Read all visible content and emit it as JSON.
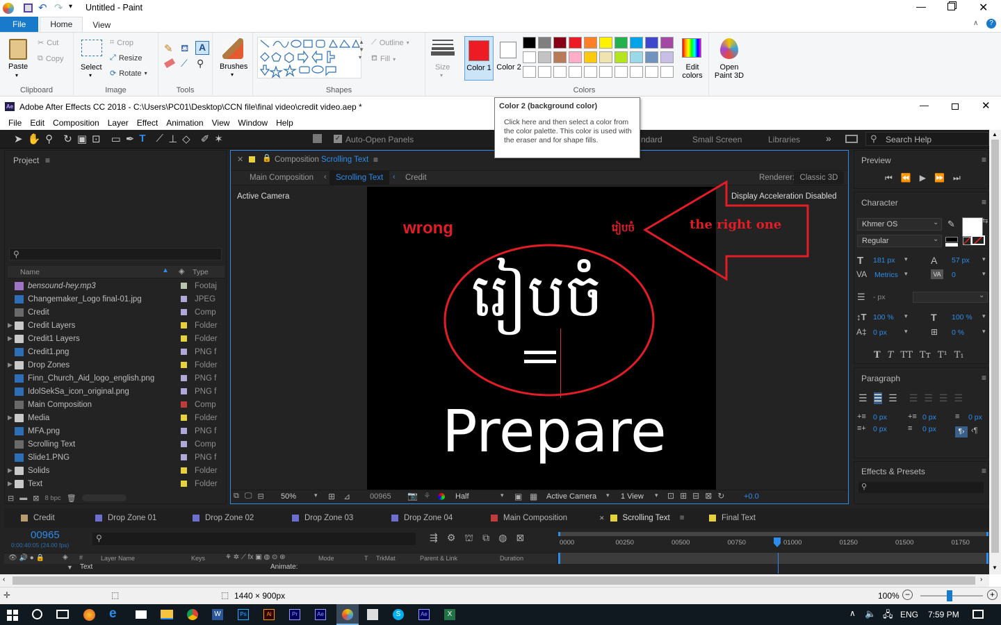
{
  "paint": {
    "title": "Untitled - Paint",
    "tabs": [
      "File",
      "Home",
      "View"
    ],
    "clipboard": {
      "paste": "Paste",
      "cut": "Cut",
      "copy": "Copy",
      "label": "Clipboard"
    },
    "image": {
      "select": "Select",
      "crop": "Crop",
      "resize": "Resize",
      "rotate": "Rotate",
      "label": "Image"
    },
    "tools": {
      "label": "Tools"
    },
    "brushes": "Brushes",
    "shapes": {
      "outline": "Outline",
      "fill": "Fill",
      "label": "Shapes"
    },
    "size": "Size",
    "colors": {
      "color1": "Color 1",
      "color2": "Color 2",
      "label": "Colors",
      "edit": "Edit colors",
      "open3d": "Open Paint 3D",
      "color1_value": "#ed1c24",
      "color2_value": "#ffffff",
      "palette_row1": [
        "#000000",
        "#7f7f7f",
        "#880015",
        "#ed1c24",
        "#ff7f27",
        "#fff200",
        "#22b14c",
        "#00a2e8",
        "#3f48cc",
        "#a349a4"
      ],
      "palette_row2": [
        "#ffffff",
        "#c3c3c3",
        "#b97a57",
        "#ffaec9",
        "#ffc90e",
        "#efe4b0",
        "#b5e61d",
        "#99d9ea",
        "#7092be",
        "#c8bfe7"
      ]
    },
    "tooltip": {
      "title": "Color 2 (background color)",
      "body": "Click here and then select a color from the color palette. This color is used with the eraser and for shape fills."
    },
    "status": {
      "size": "1440 × 900px",
      "zoom": "100%"
    }
  },
  "ae": {
    "title": "Adobe After Effects CC 2018 - C:\\Users\\PC01\\Desktop\\CCN file\\final video\\credit video.aep *",
    "menu": [
      "File",
      "Edit",
      "Composition",
      "Layer",
      "Effect",
      "Animation",
      "View",
      "Window",
      "Help"
    ],
    "toolbar": {
      "auto_open": "Auto-Open Panels",
      "ws_standard": "ndard",
      "ws_small": "Small Screen",
      "ws_libraries": "Libraries",
      "search_help": "Search Help"
    },
    "project": {
      "title": "Project",
      "col_name": "Name",
      "col_type": "Type",
      "bpc": "8 bpc",
      "items": [
        {
          "name": "bensound-hey.mp3",
          "type": "Footaj",
          "folder": false,
          "label": "#b9c5b0",
          "icon": "#a074c4",
          "italic": true
        },
        {
          "name": "Changemaker_Logo final-01.jpg",
          "type": "JPEG",
          "folder": false,
          "label": "#b0a8d8",
          "icon": "#2f6db6",
          "italic": false
        },
        {
          "name": "Credit",
          "type": "Comp",
          "folder": false,
          "label": "#b0a8d8",
          "icon": "#6a6a6a",
          "italic": false
        },
        {
          "name": "Credit Layers",
          "type": "Folder",
          "folder": true,
          "label": "#e6d13c",
          "icon": "#c9c9c9",
          "italic": false
        },
        {
          "name": "Credit1 Layers",
          "type": "Folder",
          "folder": true,
          "label": "#e6d13c",
          "icon": "#c9c9c9",
          "italic": false
        },
        {
          "name": "Credit1.png",
          "type": "PNG f",
          "folder": false,
          "label": "#b0a8d8",
          "icon": "#2f6db6",
          "italic": false
        },
        {
          "name": "Drop Zones",
          "type": "Folder",
          "folder": true,
          "label": "#e6d13c",
          "icon": "#c9c9c9",
          "italic": false
        },
        {
          "name": "Finn_Church_Aid_logo_english.png",
          "type": "PNG f",
          "folder": false,
          "label": "#b0a8d8",
          "icon": "#2f6db6",
          "italic": false
        },
        {
          "name": "IdolSekSa_icon_original.png",
          "type": "PNG f",
          "folder": false,
          "label": "#b0a8d8",
          "icon": "#2f6db6",
          "italic": false
        },
        {
          "name": "Main Composition",
          "type": "Comp",
          "folder": false,
          "label": "#c23b3b",
          "icon": "#6a6a6a",
          "italic": false
        },
        {
          "name": "Media",
          "type": "Folder",
          "folder": true,
          "label": "#e6d13c",
          "icon": "#c9c9c9",
          "italic": false
        },
        {
          "name": "MFA.png",
          "type": "PNG f",
          "folder": false,
          "label": "#b0a8d8",
          "icon": "#2f6db6",
          "italic": false
        },
        {
          "name": "Scrolling Text",
          "type": "Comp",
          "folder": false,
          "label": "#b0a8d8",
          "icon": "#6a6a6a",
          "italic": false
        },
        {
          "name": "Slide1.PNG",
          "type": "PNG f",
          "folder": false,
          "label": "#b0a8d8",
          "icon": "#2f6db6",
          "italic": false
        },
        {
          "name": "Solids",
          "type": "Folder",
          "folder": true,
          "label": "#e6d13c",
          "icon": "#c9c9c9",
          "italic": false
        },
        {
          "name": "Text",
          "type": "Folder",
          "folder": true,
          "label": "#e6d13c",
          "icon": "#c9c9c9",
          "italic": false
        }
      ]
    },
    "comp": {
      "title_prefix": "Composition",
      "title_name": "Scrolling Text",
      "crumbs": [
        "Main Composition",
        "Scrolling Text",
        "Credit"
      ],
      "renderer_label": "Renderer:",
      "renderer": "Classic 3D",
      "active_camera": "Active Camera",
      "accel": "Display Acceleration Disabled",
      "wrong": "wrong",
      "right": "the right one",
      "khmer_small": "រៀបចំ",
      "khmer_big": "រៀបចំ",
      "prepare": "Prepare",
      "zoom": "50%",
      "time": "00965",
      "resolution": "Half",
      "camera": "Active Camera",
      "view": "1 View",
      "exposure": "+0.0"
    },
    "preview": {
      "title": "Preview"
    },
    "character": {
      "title": "Character",
      "font": "Khmer OS",
      "style": "Regular",
      "size": "181 px",
      "leading": "57 px",
      "kerning": "Metrics",
      "tracking": "0",
      "stroke": "- px",
      "vscale": "100 %",
      "hscale": "100 %",
      "baseline": "0 px",
      "tsume": "0 %"
    },
    "paragraph": {
      "title": "Paragraph",
      "v1": "0 px",
      "v2": "0 px",
      "v3": "0 px",
      "v4": "0 px",
      "v5": "0 px"
    },
    "effects": {
      "title": "Effects & Presets"
    },
    "timeline": {
      "tabs": [
        {
          "name": "Credit",
          "color": "#b89c6e",
          "active": false
        },
        {
          "name": "Drop Zone 01",
          "color": "#6d6fd0",
          "active": false
        },
        {
          "name": "Drop Zone 02",
          "color": "#6d6fd0",
          "active": false
        },
        {
          "name": "Drop Zone 03",
          "color": "#6d6fd0",
          "active": false
        },
        {
          "name": "Drop Zone 04",
          "color": "#6d6fd0",
          "active": false
        },
        {
          "name": "Main Composition",
          "color": "#c23b3b",
          "active": false
        },
        {
          "name": "Scrolling Text",
          "color": "#e6d13c",
          "active": true
        },
        {
          "name": "Final Text",
          "color": "#e6d13c",
          "active": false
        }
      ],
      "timecode": "00965",
      "timesub": "0:00:40:05 (24.00 fps)",
      "cols": {
        "layer": "Layer Name",
        "keys": "Keys",
        "mode": "Mode",
        "t": "T",
        "trkmat": "TrkMat",
        "parent": "Parent & Link",
        "duration": "Duration"
      },
      "ruler": [
        "0000",
        "00250",
        "00500",
        "00750",
        "01000",
        "01250",
        "01500",
        "01750"
      ],
      "row": "Text",
      "animate": "Animate:"
    }
  },
  "taskbar": {
    "lang": "ENG",
    "time": "7:59 PM"
  }
}
